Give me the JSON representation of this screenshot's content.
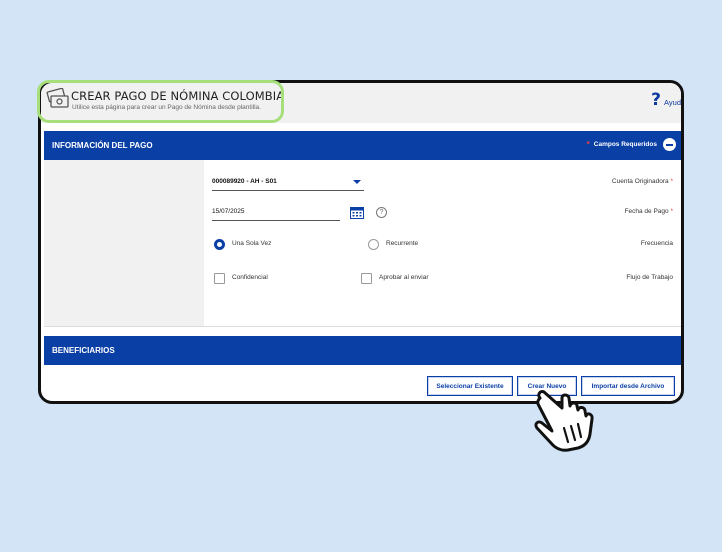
{
  "header": {
    "title": "CREAR PAGO DE NÓMINA COLOMBIA",
    "subtitle": "Utilice esta página para crear un Pago de Nómina desde plantilla.",
    "help_icon": "?",
    "help_label": "Ayud"
  },
  "payment_section": {
    "title": "INFORMACIÓN DEL PAGO",
    "required_star": "*",
    "required_label": "Campos Requeridos"
  },
  "form": {
    "account_label": "Cuenta Originadora",
    "account_value": "000089920 - AH - S01",
    "date_label": "Fecha de Pago",
    "date_value": "15/07/2025",
    "required_mark": "*",
    "frequency_label": "Frecuencia",
    "frequency_options": [
      "Una Sola Vez",
      "Recurrente"
    ],
    "frequency_selected": "Una Sola Vez",
    "workflow_label": "Flujo de Trabajo",
    "workflow_options": [
      "Confidencial",
      "Aprobar al enviar"
    ],
    "info_icon": "?"
  },
  "beneficiaries_section": {
    "title": "BENEFICIARIOS"
  },
  "buttons": {
    "select_existing": "Seleccionar Existente",
    "create_new": "Crear Nuevo",
    "import_file": "Importar desde Archivo"
  },
  "colors": {
    "brand_blue": "#0a3fa6",
    "highlight_green": "#a7df7a",
    "required_red": "#e84242"
  },
  "icons": {
    "header": "money-bills-icon",
    "calendar": "calendar-icon",
    "pointer": "pointing-hand-cursor"
  }
}
